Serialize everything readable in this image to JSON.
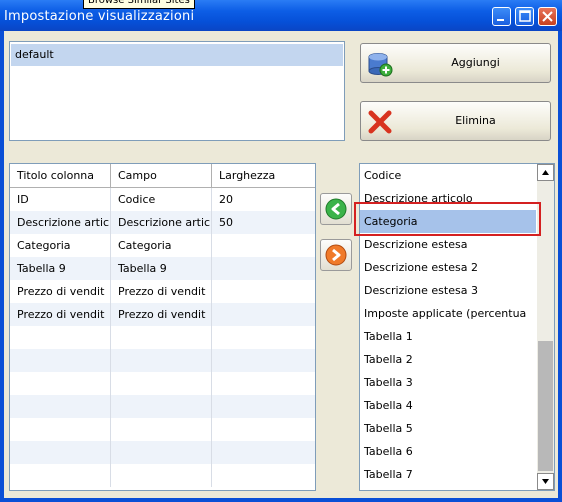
{
  "window": {
    "title": "Impostazione visualizzazioni",
    "tooltip": "Browse Similar Sites"
  },
  "profiles": {
    "items": [
      "default"
    ]
  },
  "buttons": {
    "add_label": "Aggiungi",
    "delete_label": "Elimina"
  },
  "grid": {
    "headers": [
      "Titolo colonna",
      "Campo",
      "Larghezza"
    ],
    "rows": [
      [
        "ID",
        "Codice",
        "20"
      ],
      [
        "Descrizione artic",
        "Descrizione artic",
        "50"
      ],
      [
        "Categoria",
        "Categoria",
        ""
      ],
      [
        "Tabella 9",
        "Tabella 9",
        ""
      ],
      [
        "Prezzo di vendit",
        "Prezzo di vendit",
        ""
      ],
      [
        "Prezzo di vendit",
        "Prezzo di vendit",
        ""
      ]
    ]
  },
  "fields": {
    "items": [
      "Codice",
      "Descrizione articolo",
      "Categoria",
      "Descrizione estesa",
      "Descrizione estesa 2",
      "Descrizione estesa 3",
      "Imposte applicate (percentua",
      "Tabella 1",
      "Tabella 2",
      "Tabella 3",
      "Tabella 4",
      "Tabella 5",
      "Tabella 6",
      "Tabella 7"
    ],
    "selected": "Categoria"
  },
  "icons": {
    "add": "database-add-icon",
    "delete": "red-x-icon",
    "left": "green-left-arrow-icon",
    "right": "orange-right-arrow-icon"
  },
  "colors": {
    "titlebar": "#0a4fd6",
    "selection": "#a6c2ea",
    "highlight_box": "#d42020"
  }
}
